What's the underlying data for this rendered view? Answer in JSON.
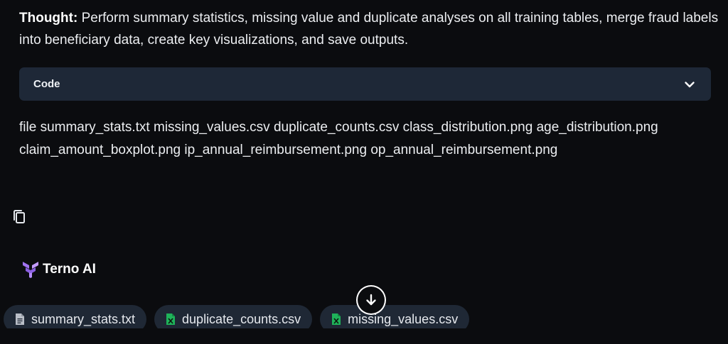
{
  "thought": {
    "label": "Thought:",
    "text": " Perform summary statistics, missing value and duplicate analyses on all training tables, merge fraud labels into beneficiary data, create key visualizations, and save outputs."
  },
  "code_section": {
    "label": "Code",
    "icon": "chevron-down-icon"
  },
  "files_output": "file summary_stats.txt missing_values.csv duplicate_counts.csv class_distribution.png age_distribution.png claim_amount_boxplot.png ip_annual_reimbursement.png op_annual_reimbursement.png",
  "copy_icon": "copy-icon",
  "assistant": {
    "name": "Terno AI",
    "logo_color": "#a173f0"
  },
  "scroll_icon": "arrow-down-icon",
  "attachments": [
    {
      "name": "summary_stats.txt",
      "icon": "text-file-icon",
      "color": "#b9bec7"
    },
    {
      "name": "duplicate_counts.csv",
      "icon": "spreadsheet-file-icon",
      "color": "#1fb35a"
    },
    {
      "name": "missing_values.csv",
      "icon": "spreadsheet-file-icon",
      "color": "#1fb35a"
    }
  ]
}
